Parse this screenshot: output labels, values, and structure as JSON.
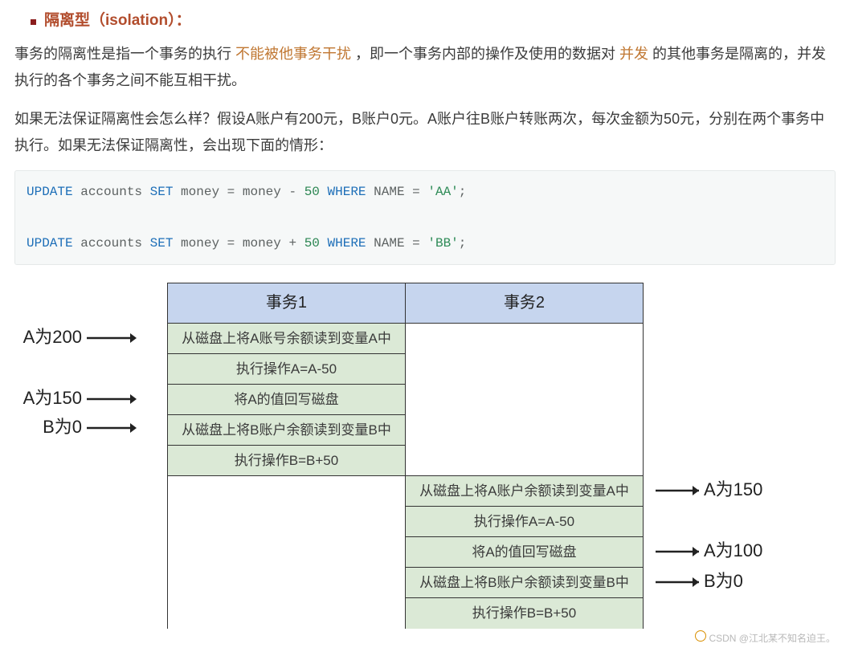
{
  "heading": "隔离型（isolation）：",
  "para1_a": "事务的隔离性是指一个事务的执行 ",
  "para1_hl1": "不能被他事务干扰 ",
  "para1_b": "，即一个事务内部的操作及使用的数据对 ",
  "para1_hl2": "并发 ",
  "para1_c": "的其他事务是隔离的，并发执行的各个事务之间不能互相干扰。",
  "para2": "如果无法保证隔离性会怎么样？假设A账户有200元，B账户0元。A账户往B账户转账两次，每次金额为50元，分别在两个事务中执行。如果无法保证隔离性，会出现下面的情形：",
  "code": {
    "l1_kw1": "UPDATE",
    "l1_t1": " accounts ",
    "l1_kw2": "SET",
    "l1_t2": " money ",
    "l1_op1": "=",
    "l1_t3": " money ",
    "l1_op2": "-",
    "l1_sp": " ",
    "l1_num": "50",
    "l1_sp2": " ",
    "l1_kw3": "WHERE",
    "l1_t4": " NAME ",
    "l1_op3": "=",
    "l1_sp3": " ",
    "l1_str": "'AA'",
    "l1_end": ";",
    "l2_kw1": "UPDATE",
    "l2_t1": " accounts ",
    "l2_kw2": "SET",
    "l2_t2": " money ",
    "l2_op1": "=",
    "l2_t3": " money ",
    "l2_op2": "+",
    "l2_sp": " ",
    "l2_num": "50",
    "l2_sp2": " ",
    "l2_kw3": "WHERE",
    "l2_t4": " NAME ",
    "l2_op3": "=",
    "l2_sp3": " ",
    "l2_str": "'BB'",
    "l2_end": ";"
  },
  "table": {
    "header1": "事务1",
    "header2": "事务2",
    "t1": {
      "r1": "从磁盘上将A账号余额读到变量A中",
      "r2": "执行操作A=A-50",
      "r3": "将A的值回写磁盘",
      "r4": "从磁盘上将B账户余额读到变量B中",
      "r5": "执行操作B=B+50"
    },
    "t2": {
      "r1": "从磁盘上将A账户余额读到变量A中",
      "r2": "执行操作A=A-50",
      "r3": "将A的值回写磁盘",
      "r4": "从磁盘上将B账户余额读到变量B中",
      "r5": "执行操作B=B+50"
    }
  },
  "annotations": {
    "left1": "A为200",
    "left2": "A为150",
    "left3": "B为0",
    "right1": "A为150",
    "right2": "A为100",
    "right3": "B为0"
  },
  "watermark": "CSDN @江北某不知名迫王。"
}
